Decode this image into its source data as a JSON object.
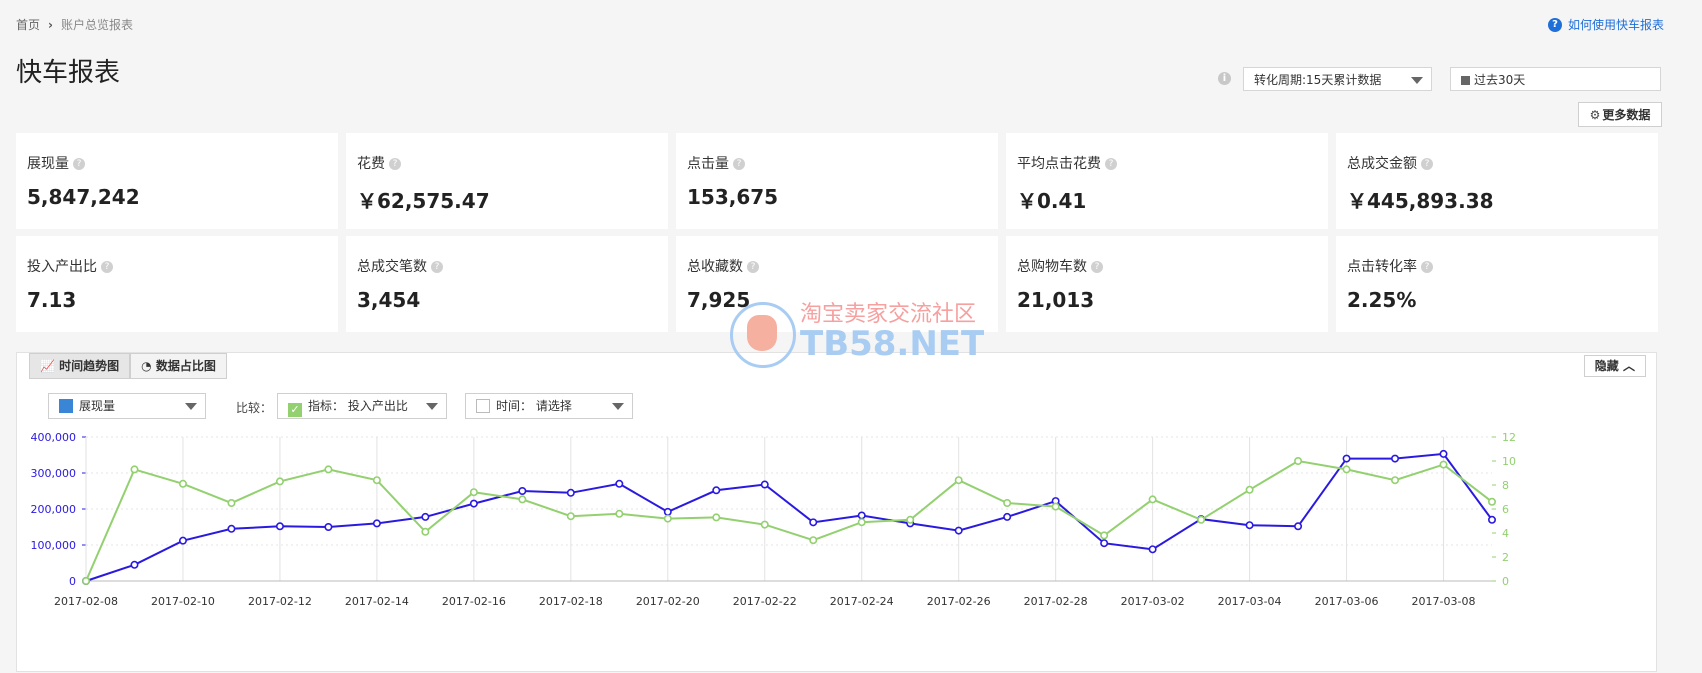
{
  "breadcrumb": {
    "home": "首页",
    "current": "账户总览报表"
  },
  "help_link": "如何使用快车报表",
  "page_title": "快车报表",
  "period_select": "转化周期:15天累计数据",
  "date_select": "过去30天",
  "more_button": "更多数据",
  "cards": [
    {
      "label": "展现量",
      "value": "5,847,242"
    },
    {
      "label": "花费",
      "value": "￥62,575.47"
    },
    {
      "label": "点击量",
      "value": "153,675"
    },
    {
      "label": "平均点击花费",
      "value": "￥0.41"
    },
    {
      "label": "总成交金额",
      "value": "￥445,893.38"
    },
    {
      "label": "投入产出比",
      "value": "7.13"
    },
    {
      "label": "总成交笔数",
      "value": "3,454"
    },
    {
      "label": "总收藏数",
      "value": "7,925"
    },
    {
      "label": "总购物车数",
      "value": "21,013"
    },
    {
      "label": "点击转化率",
      "value": "2.25%"
    }
  ],
  "tabs": {
    "trend": "时间趋势图",
    "share": "数据占比图"
  },
  "hide_button": "隐藏",
  "primary_metric": "展现量",
  "compare_label": "比较：",
  "compare_metric": "指标： 投入产出比",
  "time_compare": "时间： 请选择",
  "watermark": {
    "cn": "淘宝卖家交流社区",
    "en": "TB58.NET"
  },
  "colors": {
    "primary": "#2a1ae0",
    "secondary": "#93d06f",
    "accent": "#1e6fd9"
  },
  "chart_data": {
    "type": "line",
    "x": [
      "2017-02-08",
      "2017-02-09",
      "2017-02-10",
      "2017-02-11",
      "2017-02-12",
      "2017-02-13",
      "2017-02-14",
      "2017-02-15",
      "2017-02-16",
      "2017-02-17",
      "2017-02-18",
      "2017-02-19",
      "2017-02-20",
      "2017-02-21",
      "2017-02-22",
      "2017-02-23",
      "2017-02-24",
      "2017-02-25",
      "2017-02-26",
      "2017-02-27",
      "2017-02-28",
      "2017-03-01",
      "2017-03-02",
      "2017-03-03",
      "2017-03-04",
      "2017-03-05",
      "2017-03-06",
      "2017-03-07",
      "2017-03-08",
      "2017-03-09"
    ],
    "x_tick_labels": [
      "2017-02-08",
      "2017-02-10",
      "2017-02-12",
      "2017-02-14",
      "2017-02-16",
      "2017-02-18",
      "2017-02-20",
      "2017-02-22",
      "2017-02-24",
      "2017-02-26",
      "2017-02-28",
      "2017-03-02",
      "2017-03-04",
      "2017-03-06",
      "2017-03-08"
    ],
    "y_left_ticks": [
      "0",
      "100,000",
      "200,000",
      "300,000",
      "400,000"
    ],
    "y_right_ticks": [
      "0",
      "2",
      "4",
      "6",
      "8",
      "10",
      "12"
    ],
    "ylim_left": [
      0,
      400000
    ],
    "ylim_right": [
      0,
      12
    ],
    "grid": true,
    "series": [
      {
        "name": "展现量",
        "axis": "left",
        "color": "#2a1ae0",
        "values": [
          0,
          45000,
          112000,
          145000,
          152000,
          150000,
          160000,
          178000,
          215000,
          250000,
          245000,
          270000,
          192000,
          252000,
          268000,
          163000,
          182000,
          160000,
          140000,
          178000,
          222000,
          105000,
          88000,
          172000,
          155000,
          152000,
          340000,
          340000,
          353000,
          170000
        ]
      },
      {
        "name": "投入产出比",
        "axis": "right",
        "color": "#93d06f",
        "values": [
          0,
          9.3,
          8.1,
          6.5,
          8.3,
          9.3,
          8.4,
          4.1,
          7.4,
          6.8,
          5.4,
          5.6,
          5.2,
          5.3,
          4.7,
          3.4,
          4.9,
          5.1,
          8.4,
          6.5,
          6.2,
          3.8,
          6.8,
          5.1,
          7.6,
          10.0,
          9.3,
          8.4,
          9.7,
          6.6
        ]
      }
    ]
  }
}
